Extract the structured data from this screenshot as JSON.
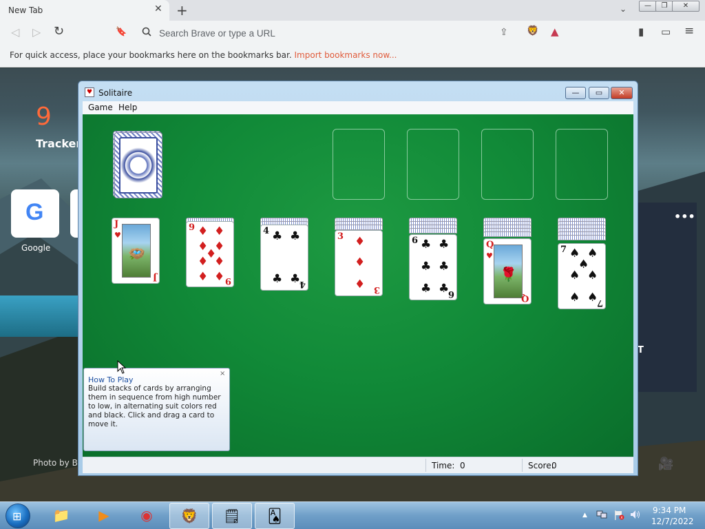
{
  "browser": {
    "tab_title": "New Tab",
    "tab_close": "✕",
    "new_tab": "+",
    "tab_dropdown": "⌄",
    "window_min": "—",
    "window_restore": "❐",
    "window_close": "✕",
    "back": "◁",
    "forward": "▷",
    "reload": "↻",
    "bookmark_icon": "🔖",
    "search_placeholder": "Search Brave or type a URL",
    "share_icon": "⇪",
    "shield_icon": "🦁",
    "rewards_icon": "▲",
    "sidebar_icon": "▮",
    "wallet_icon": "▭",
    "menu_icon": "≡",
    "bookmarks_message": "For quick access, place your bookmarks here on the bookmarks bar.",
    "bookmarks_import": "Import bookmarks now..."
  },
  "ntp": {
    "trackers_count": "9",
    "trackers_label": "Tracker",
    "google_tile_label": "Google",
    "google_letter": "G",
    "photo_credit": "Photo by Bo",
    "widget_dots": "•••",
    "widget_letter": "T",
    "camera_icon": "🎥"
  },
  "solitaire": {
    "title": "Solitaire",
    "menu": [
      "Game",
      "Help"
    ],
    "minimize": "—",
    "maximize": "▭",
    "close": "✕",
    "tableau": [
      {
        "rank": "J",
        "suit": "♥",
        "color": "red",
        "hidden": 0
      },
      {
        "rank": "9",
        "suit": "♦",
        "color": "red",
        "hidden": 1
      },
      {
        "rank": "4",
        "suit": "♣",
        "color": "black",
        "hidden": 2
      },
      {
        "rank": "3",
        "suit": "♦",
        "color": "red",
        "hidden": 3
      },
      {
        "rank": "6",
        "suit": "♣",
        "color": "black",
        "hidden": 4
      },
      {
        "rank": "Q",
        "suit": "♥",
        "color": "red",
        "hidden": 5
      },
      {
        "rank": "7",
        "suit": "♠",
        "color": "black",
        "hidden": 6
      }
    ],
    "howto_title": "How To Play",
    "howto_body": "Build stacks of cards by arranging them in sequence from high number to low, in alternating suit colors red and black. Click and drag a card to move it.",
    "howto_close": "×",
    "status": {
      "time_label": "Time:",
      "time_value": "0",
      "score_label": "Score:",
      "score_value": "0"
    }
  },
  "taskbar": {
    "start_icon": "⊞",
    "apps": [
      {
        "name": "explorer",
        "icon": "📁",
        "active": false
      },
      {
        "name": "media-player",
        "icon": "▶",
        "active": false
      },
      {
        "name": "chrome",
        "icon": "◉",
        "active": false
      },
      {
        "name": "brave",
        "icon": "🦁",
        "active": true
      },
      {
        "name": "sticky-notes",
        "icon": "🗒",
        "active": true
      },
      {
        "name": "solitaire",
        "icon": "🂡",
        "active": true
      }
    ],
    "tray_arrow": "▲",
    "time": "9:34 PM",
    "date": "12/7/2022"
  }
}
